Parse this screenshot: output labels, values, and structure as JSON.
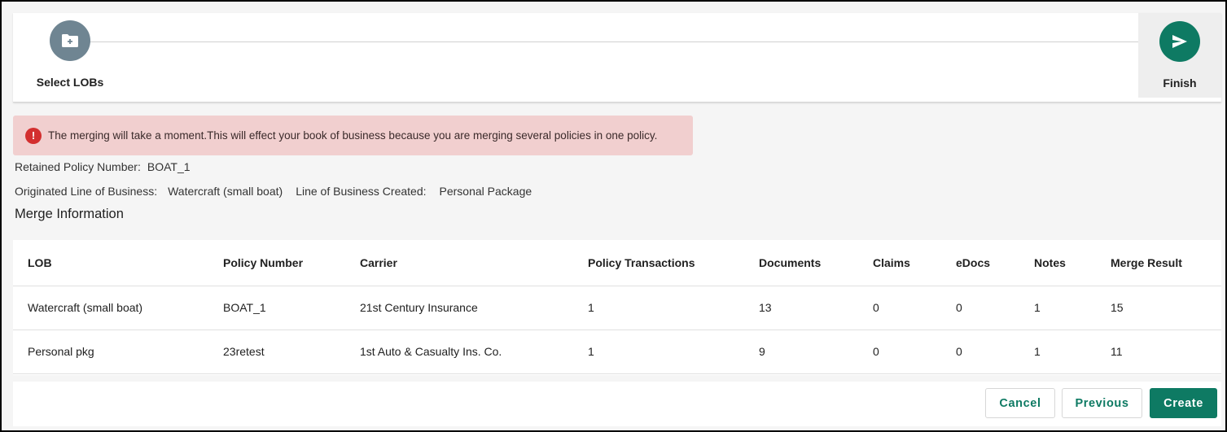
{
  "stepper": {
    "steps": [
      {
        "label": "Select LOBs",
        "icon": "folder-add-icon"
      },
      {
        "label": "Finish",
        "icon": "send-icon"
      }
    ],
    "colors": {
      "inactive": "#6f8592",
      "active": "#0e7a63"
    }
  },
  "alert": {
    "icon": "error-icon",
    "icon_glyph": "!",
    "text": "The merging will take a moment.This will effect your book of business because you are merging several policies in one policy.",
    "color": "#f1cfcf"
  },
  "info": {
    "retained_label": "Retained Policy Number:",
    "retained_value": "BOAT_1",
    "originated_label": "Originated Line of Business:",
    "originated_value": "Watercraft (small boat)",
    "created_label": "Line of Business Created:",
    "created_value": "Personal Package"
  },
  "section_title": "Merge Information",
  "table": {
    "headers": [
      "LOB",
      "Policy Number",
      "Carrier",
      "Policy Transactions",
      "Documents",
      "Claims",
      "eDocs",
      "Notes",
      "Merge Result"
    ],
    "rows": [
      [
        "Watercraft (small boat)",
        "BOAT_1",
        "21st Century Insurance",
        "1",
        "13",
        "0",
        "0",
        "1",
        "15"
      ],
      [
        "Personal pkg",
        "23retest",
        "1st Auto & Casualty Ins. Co.",
        "1",
        "9",
        "0",
        "0",
        "1",
        "11"
      ]
    ]
  },
  "buttons": {
    "cancel": "Cancel",
    "previous": "Previous",
    "create": "Create"
  }
}
